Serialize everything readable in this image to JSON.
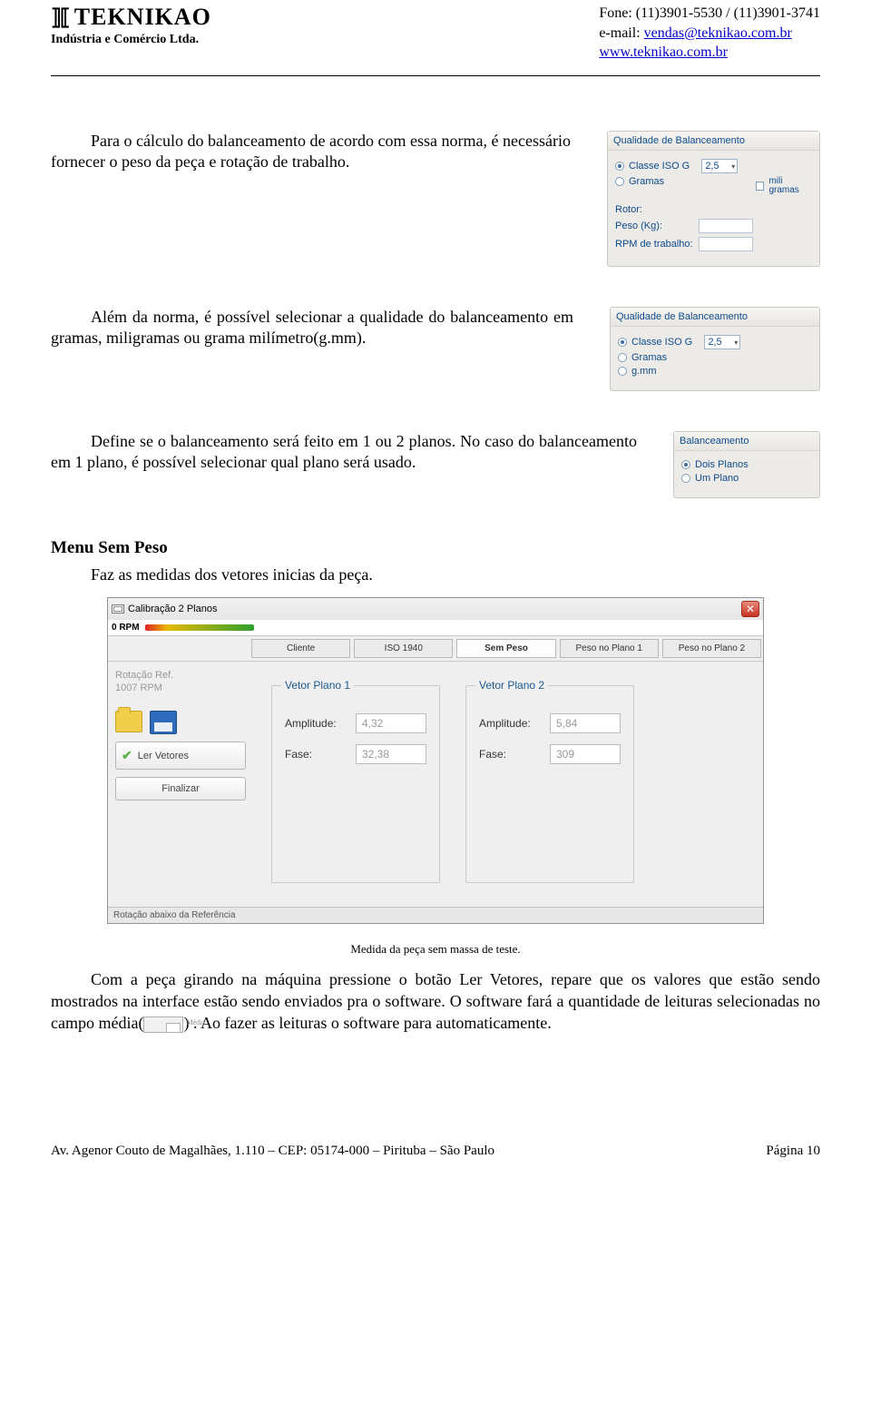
{
  "header": {
    "company": "TEKNIKAO",
    "subtitle": "Indústria e Comércio Ltda.",
    "phone": "Fone: (11)3901-5530 / (11)3901-3741",
    "email_label": "e-mail: ",
    "email": "vendas@teknikao.com.br",
    "site": "www.teknikao.com.br"
  },
  "section1": {
    "text": "Para o cálculo do balanceamento de acordo com essa norma, é necessário fornecer o peso da peça e rotação de trabalho.",
    "panel": {
      "title": "Qualidade de Balanceamento",
      "opt1": "Classe ISO G",
      "opt1_val": "2,5",
      "opt2": "Gramas",
      "chk_label": "mili gramas",
      "rotor_label": "Rotor:",
      "peso_label": "Peso (Kg):",
      "rpm_label": "RPM de trabalho:"
    }
  },
  "section2": {
    "text": "Além da norma, é possível selecionar a qualidade do balanceamento em gramas, miligramas ou grama milímetro(g.mm).",
    "panel": {
      "title": "Qualidade de Balanceamento",
      "opt1": "Classe ISO G",
      "opt1_val": "2,5",
      "opt2": "Gramas",
      "opt3": "g.mm"
    }
  },
  "section3": {
    "text": "Define se o balanceamento será feito em 1 ou 2 planos. No caso do balanceamento em 1 plano, é possível selecionar qual plano será usado.",
    "panel": {
      "title": "Balanceamento",
      "opt1": "Dois Planos",
      "opt2": "Um Plano"
    }
  },
  "menu": {
    "heading": "Menu Sem Peso",
    "line": "Faz as medidas dos vetores inicias da peça."
  },
  "app": {
    "title": "Calibração 2 Planos",
    "rpm": "0 RPM",
    "tabs": {
      "t1": "Cliente",
      "t2": "ISO 1940",
      "t3": "Sem Peso",
      "t4": "Peso no Plano 1",
      "t5": "Peso no Plano 2"
    },
    "side": {
      "rot_label": "Rotação Ref.",
      "rot_val": "1007 RPM",
      "btn1": "Ler Vetores",
      "btn2": "Finalizar"
    },
    "v1": {
      "legend": "Vetor Plano 1",
      "amp_label": "Amplitude:",
      "amp": "4,32",
      "fase_label": "Fase:",
      "fase": "32,38"
    },
    "v2": {
      "legend": "Vetor Plano 2",
      "amp_label": "Amplitude:",
      "amp": "5,84",
      "fase_label": "Fase:",
      "fase": "309"
    },
    "status": "Rotação abaixo da Referência"
  },
  "caption": "Medida da peça sem massa de teste.",
  "body_para_a": "Com a peça girando na máquina pressione o botão Ler Vetores, repare que os valores que estão sendo mostrados na interface estão sendo enviados pra o software. O software fará a quantidade de leituras selecionadas no campo média(",
  "body_para_b": ") . Ao fazer as leituras o software para automaticamente.",
  "footer": {
    "left": "Av. Agenor Couto de Magalhães, 1.110 – CEP: 05174-000 – Pirituba – São Paulo",
    "right": "Página 10"
  }
}
